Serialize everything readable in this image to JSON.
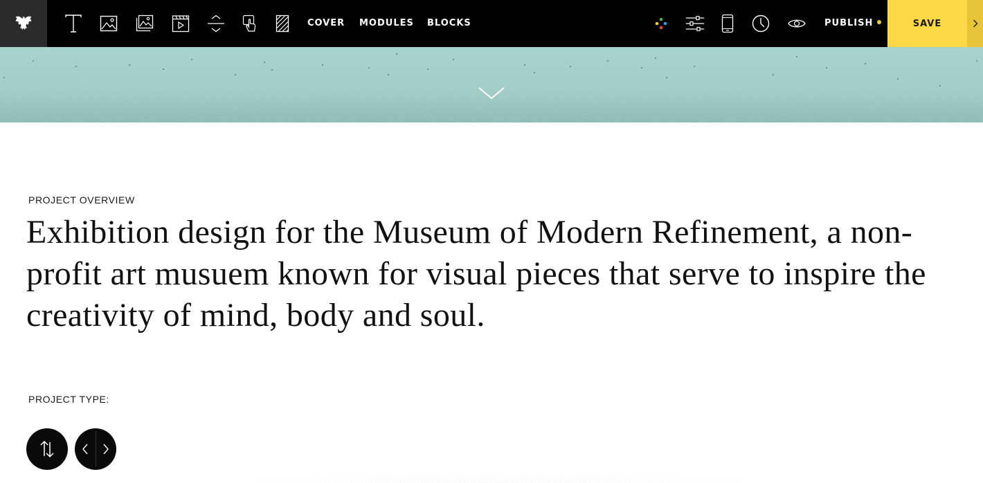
{
  "toolbar": {
    "logo_icon": "eagle-logo-icon",
    "tools": [
      {
        "name": "text-tool",
        "icon": "text-icon"
      },
      {
        "name": "image-tool",
        "icon": "image-icon"
      },
      {
        "name": "gallery-tool",
        "icon": "gallery-icon"
      },
      {
        "name": "video-tool",
        "icon": "video-icon"
      },
      {
        "name": "spacer-tool",
        "icon": "spacer-icon"
      },
      {
        "name": "interaction-tool",
        "icon": "hand-pointer-icon"
      },
      {
        "name": "pattern-tool",
        "icon": "hatch-icon"
      }
    ],
    "nav": {
      "cover": "COVER",
      "modules": "MODULES",
      "blocks": "BLOCKS"
    },
    "right_tools": [
      {
        "name": "colors-tool",
        "icon": "color-dots-icon"
      },
      {
        "name": "settings-tool",
        "icon": "sliders-icon"
      },
      {
        "name": "mobile-preview-tool",
        "icon": "mobile-icon"
      },
      {
        "name": "history-tool",
        "icon": "clock-icon"
      },
      {
        "name": "preview-tool",
        "icon": "eye-icon"
      }
    ],
    "publish_label": "PUBLISH",
    "save_label": "SAVE",
    "accent_color": "#fcd845"
  },
  "cover": {
    "background_color": "#a9d3cd",
    "chevron_icon": "chevron-down-icon"
  },
  "content": {
    "overview_label": "PROJECT OVERVIEW",
    "headline": "Exhibition design for the Museum of Modern Refinement, a non-profit art musuem known for visual pieces that serve to inspire the creativity of mind, body and soul.",
    "project_type_label": "PROJECT TYPE:"
  },
  "controls": {
    "reorder_icon": "reorder-arrows-icon",
    "prev_icon": "chevron-left-icon",
    "next_icon": "chevron-right-icon"
  },
  "colors": {
    "color_dots": [
      "#3a9be0",
      "#e94a3a",
      "#4caf50",
      "#f4cd32"
    ]
  }
}
